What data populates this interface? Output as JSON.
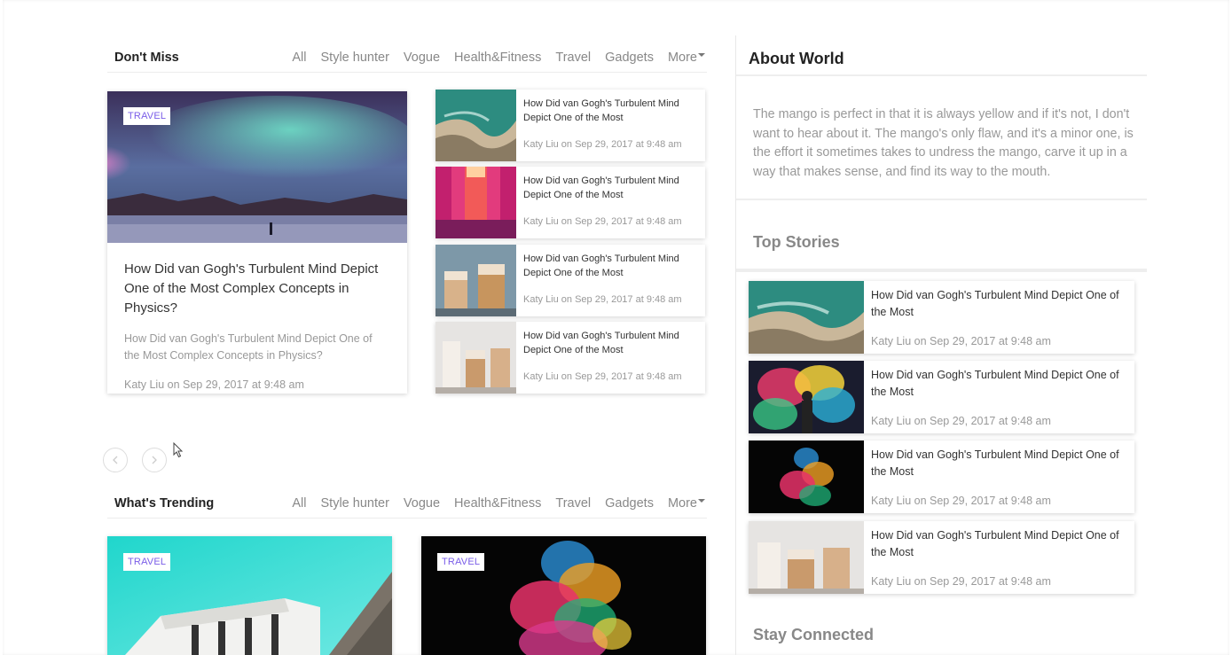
{
  "dont_miss": {
    "title": "Don't Miss",
    "tabs": [
      "All",
      "Style hunter",
      "Vogue",
      "Health&Fitness",
      "Travel",
      "Gadgets",
      "More"
    ],
    "featured": {
      "badge": "TRAVEL",
      "image": "aurora-lake-photo",
      "title": "How Did van Gogh's Turbulent Mind Depict One of the Most Complex Concepts in Physics?",
      "excerpt": "How Did van Gogh's Turbulent Mind Depict One of the Most Complex Concepts in Physics?",
      "meta": "Katy Liu on Sep 29, 2017 at 9:48 am"
    },
    "list": [
      {
        "image": "aerial-beach-photo",
        "title": "How Did van Gogh's Turbulent Mind Depict One of the Most",
        "meta": "Katy Liu on Sep 29, 2017 at 9:48 am"
      },
      {
        "image": "neon-corridor-photo",
        "title": "How Did van Gogh's Turbulent Mind Depict One of the Most",
        "meta": "Katy Liu on Sep 29, 2017 at 9:48 am"
      },
      {
        "image": "iced-coffee-photo",
        "title": "How Did van Gogh's Turbulent Mind Depict One of the Most",
        "meta": "Katy Liu on Sep 29, 2017 at 9:48 am"
      },
      {
        "image": "iced-coffee-white-photo",
        "title": "How Did van Gogh's Turbulent Mind Depict One of the Most",
        "meta": "Katy Liu on Sep 29, 2017 at 9:48 am"
      }
    ],
    "prev_icon": "chevron-left-icon",
    "next_icon": "chevron-right-icon"
  },
  "trending": {
    "title": "What's Trending",
    "tabs": [
      "All",
      "Style hunter",
      "Vogue",
      "Health&Fitness",
      "Travel",
      "Gadgets",
      "More"
    ],
    "cards": [
      {
        "badge": "TRAVEL",
        "image": "white-building-photo"
      },
      {
        "badge": "TRAVEL",
        "image": "color-smoke-photo"
      }
    ]
  },
  "about": {
    "title": "About World",
    "text": "The mango is perfect in that it is always yellow and if it's not, I don't want to hear about it. The mango's only flaw, and it's a minor one, is the effort it sometimes takes to undress the mango, carve it up in a way that makes sense, and find its way to the mouth."
  },
  "top_stories": {
    "title": "Top Stories",
    "items": [
      {
        "image": "aerial-beach-photo",
        "title": "How Did van Gogh's Turbulent Mind Depict One of the Most",
        "meta": "Katy Liu on Sep 29, 2017 at 9:48 am"
      },
      {
        "image": "color-powder-man-photo",
        "title": "How Did van Gogh's Turbulent Mind Depict One of the Most",
        "meta": "Katy Liu on Sep 29, 2017 at 9:48 am"
      },
      {
        "image": "color-smoke-photo",
        "title": "How Did van Gogh's Turbulent Mind Depict One of the Most",
        "meta": "Katy Liu on Sep 29, 2017 at 9:48 am"
      },
      {
        "image": "iced-coffee-white-photo",
        "title": "How Did van Gogh's Turbulent Mind Depict One of the Most",
        "meta": "Katy Liu on Sep 29, 2017 at 9:48 am"
      }
    ]
  },
  "stay_connected": {
    "title": "Stay Connected"
  },
  "colors": {
    "badge_text": "#7a5de8",
    "muted_text": "#999999",
    "heading": "#222222"
  }
}
